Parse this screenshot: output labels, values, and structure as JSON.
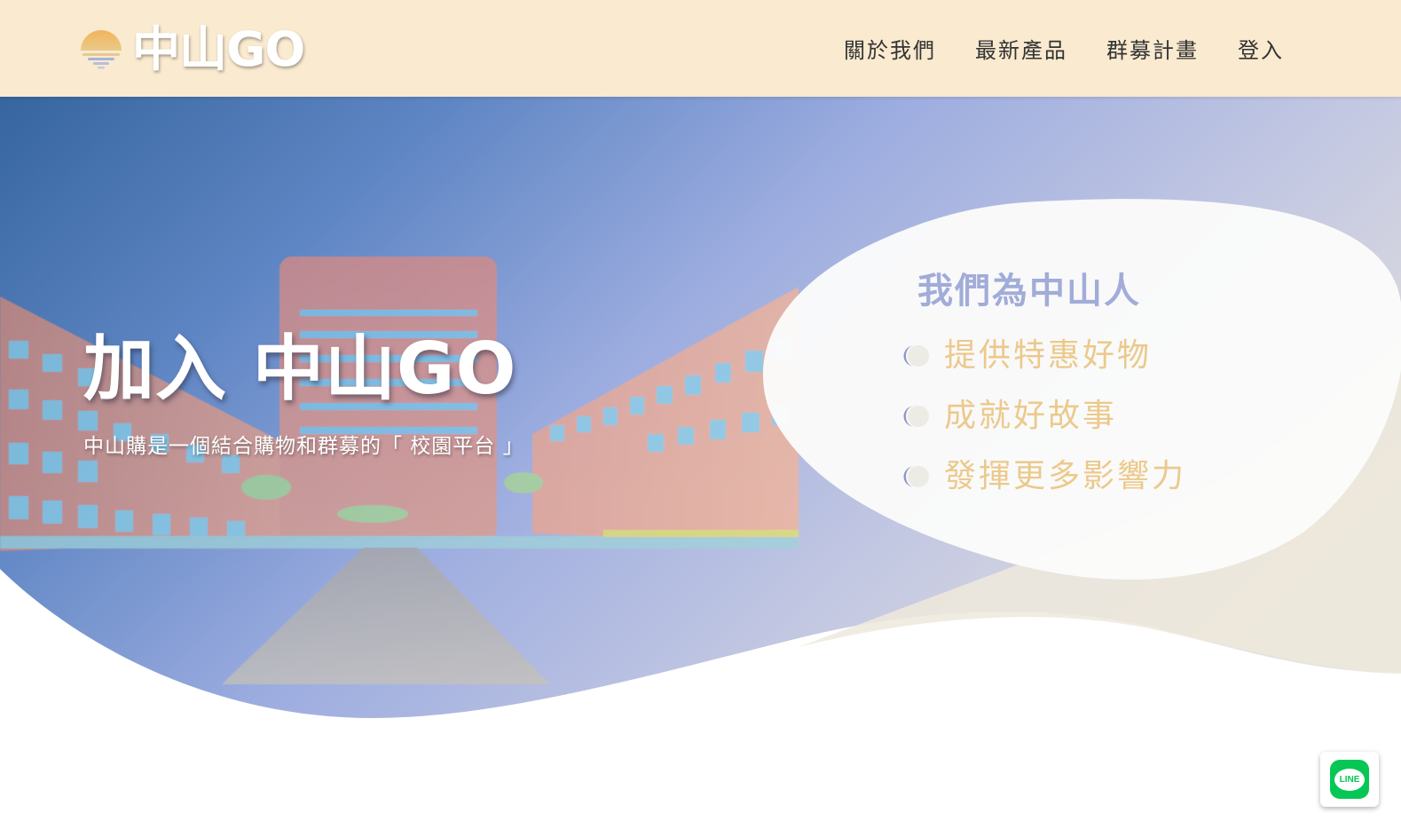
{
  "header": {
    "logo_text": "中山GO",
    "nav": [
      "關於我們",
      "最新產品",
      "群募計畫",
      "登入"
    ]
  },
  "hero": {
    "title": "加入 中山GO",
    "subtitle": "中山購是一個結合購物和群募的「 校園平台 」"
  },
  "card": {
    "heading": "我們為中山人",
    "features": [
      "提供特惠好物",
      "成就好故事",
      "發揮更多影響力"
    ]
  },
  "line_button": {
    "label": "LINE"
  },
  "colors": {
    "header_bg": "#f9ead0",
    "sky_top": "#3a6aa3",
    "sky_mid": "#9eb0e0",
    "heading_blue": "#a1acd8",
    "feature_gold": "#ecc98b",
    "line_green": "#06c755"
  },
  "icons": {
    "logo": "sun-over-water-icon",
    "feature": "moon-toggle-icon",
    "line": "line-app-icon"
  }
}
